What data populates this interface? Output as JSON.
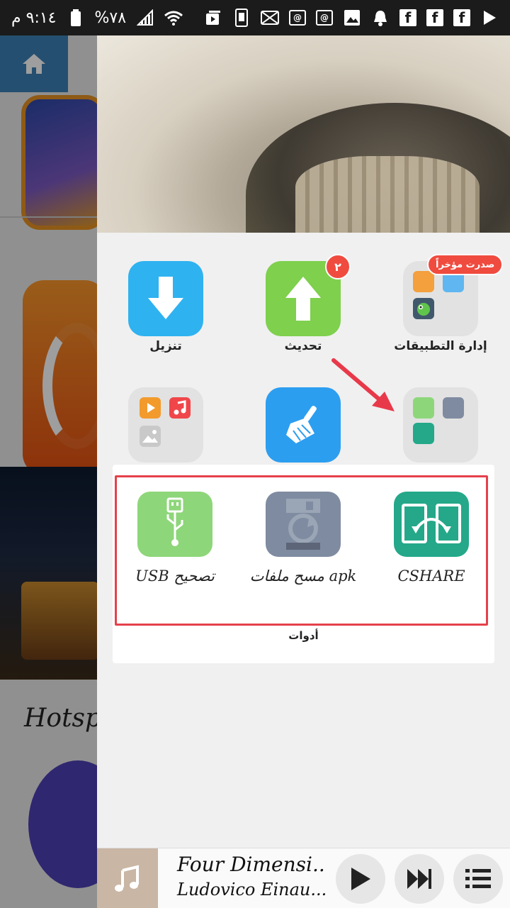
{
  "status_bar": {
    "time": "٩:١٤ م",
    "battery": "%٧٨",
    "facebook_glyph": "f",
    "email_glyph": "@"
  },
  "drawer": {
    "row1": [
      {
        "label": "تنزيل",
        "icon": "download-icon",
        "color": "#2fb2f0"
      },
      {
        "label": "تحديث",
        "icon": "upload-arrow-icon",
        "color": "#7ed04d",
        "badge": "٢"
      },
      {
        "label": "إدارة التطبيقات",
        "icon": "app-folder-icon",
        "badge": "صدرت مؤخراً"
      }
    ],
    "row2": [
      {
        "icon": "media-folder-icon"
      },
      {
        "icon": "broom-icon",
        "color": "#2c9ef0"
      },
      {
        "icon": "tools-folder-icon"
      }
    ]
  },
  "tools": {
    "title": "أدوات",
    "items": [
      {
        "label": "USB تصحيح",
        "icon": "usb-icon",
        "color": "#8ed67a"
      },
      {
        "label": "مسح ملفات apk",
        "icon": "floppy-clean-icon",
        "color": "#7f8ba0"
      },
      {
        "label": "CSHARE",
        "icon": "cshare-icon",
        "color": "#24a889"
      }
    ]
  },
  "background": {
    "hotspot_text": "Hotspo"
  },
  "player": {
    "title": "Four Dimensi..",
    "artist": "Ludovico Einau..."
  },
  "colors": {
    "highlight_frame": "#e5414b",
    "arrow": "#e8394a"
  }
}
